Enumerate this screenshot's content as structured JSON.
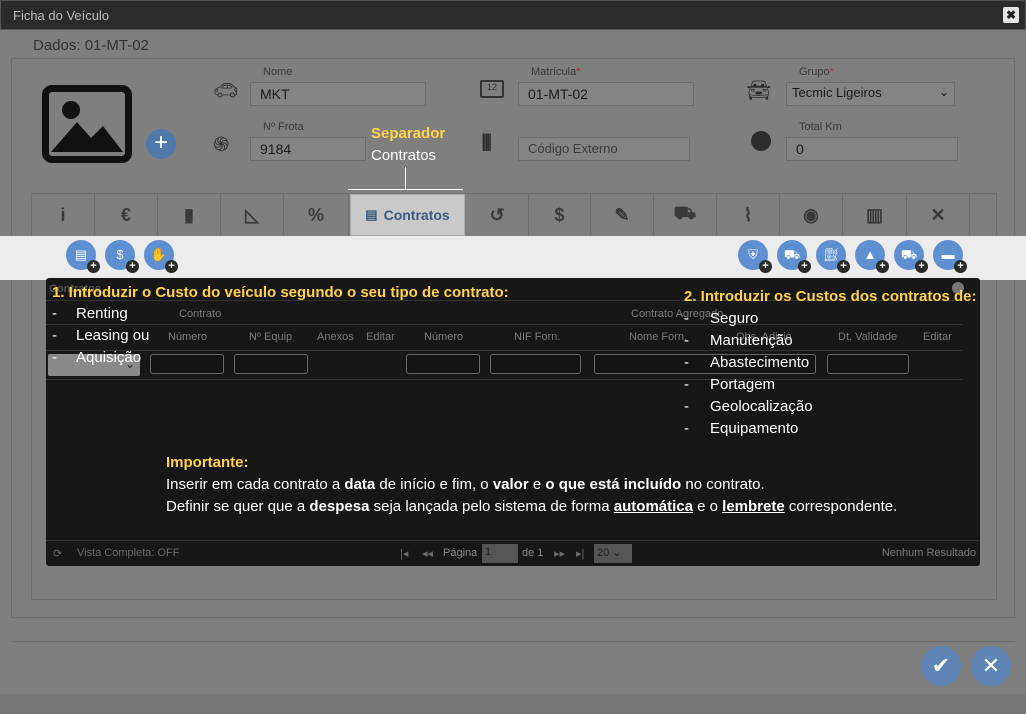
{
  "window": {
    "title": "Ficha do Veículo",
    "close": "✖"
  },
  "header": {
    "dados": "Dados: 01-MT-02"
  },
  "fields": {
    "nome": {
      "label": "Nome",
      "value": "MKT"
    },
    "matricula": {
      "label": "Matrícula",
      "required": "*",
      "value": "01-MT-02"
    },
    "grupo": {
      "label": "Grupo",
      "required": "*",
      "value": "Tecmic Ligeiros"
    },
    "frota": {
      "label": "Nº Frota",
      "value": "9184"
    },
    "codigo": {
      "placeholder": "Código Externo"
    },
    "km": {
      "label": "Total Km",
      "value": "0"
    }
  },
  "tabs": {
    "active_label": "Contratos"
  },
  "callout": {
    "title": "Separador",
    "subtitle": "Contratos"
  },
  "grid": {
    "caption": "Contratos",
    "group_contrato": "Contrato",
    "group_agregado": "Contrato Agregado",
    "columns_left": [
      "Número",
      "Nº Equip",
      "Anexos",
      "Editar"
    ],
    "columns_right": [
      "Número",
      "NIF Forn.",
      "Nome Forn.",
      "Obs. Adicio",
      "Dt. Validade",
      "Editar"
    ],
    "footer": {
      "vista": "Vista Completa: OFF",
      "pagina": "Página",
      "page_value": "1",
      "of": "de 1",
      "page_size": "20",
      "result": "Nenhum Resultado"
    }
  },
  "annotation1": {
    "title": "1. Introduzir o Custo do veículo segundo o seu tipo de contrato:",
    "items": [
      "Renting",
      "Leasing ou",
      "Aquisição"
    ]
  },
  "annotation2": {
    "title": "2. Introduzir os Custos dos contratos de:",
    "items": [
      "Seguro",
      "Manutenção",
      "Abastecimento",
      "Portagem",
      "Geolocalização",
      "Equipamento"
    ]
  },
  "important": {
    "title": "Importante:",
    "l1a": "Inserir em cada contrato a ",
    "l1b": "data",
    "l1c": " de início e fim, o ",
    "l1d": "valor",
    "l1e": " e ",
    "l1f": "o que está incluído",
    "l1g": " no contrato.",
    "l2a": "Definir se quer que a ",
    "l2b": "despesa",
    "l2c": " seja lançada pelo sistema de forma ",
    "l2d": "automática",
    "l2e": " e o ",
    "l2f": "lembrete",
    "l2g": " correspondente."
  },
  "dash": "-",
  "colors": {
    "accent": "#ffd24d",
    "button": "#5e8fd0"
  }
}
